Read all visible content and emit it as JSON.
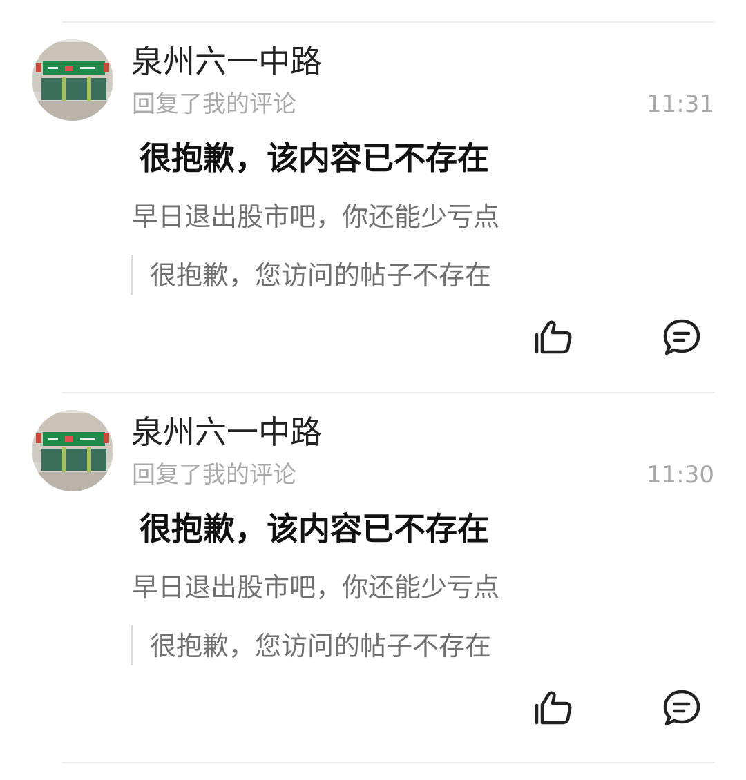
{
  "notifications": [
    {
      "username": "泉州六一中路",
      "action": "回复了我的评论",
      "time": "11:31",
      "deleted_notice": "很抱歉，该内容已不存在",
      "reply": "早日退出股市吧，你还能少亏点",
      "quoted": "很抱歉，您访问的帖子不存在",
      "icons": {
        "avatar": "shop-avatar",
        "like": "thumbs-up-icon",
        "comment": "comment-bubble-icon"
      }
    },
    {
      "username": "泉州六一中路",
      "action": "回复了我的评论",
      "time": "11:30",
      "deleted_notice": "很抱歉，该内容已不存在",
      "reply": "早日退出股市吧，你还能少亏点",
      "quoted": "很抱歉，您访问的帖子不存在",
      "icons": {
        "avatar": "shop-avatar",
        "like": "thumbs-up-icon",
        "comment": "comment-bubble-icon"
      }
    }
  ],
  "colors": {
    "text_primary": "#111111",
    "text_secondary": "#707070",
    "text_muted": "#a8a8a8",
    "divider": "#eeeeee",
    "shop_sign": "#1f8a4c"
  }
}
